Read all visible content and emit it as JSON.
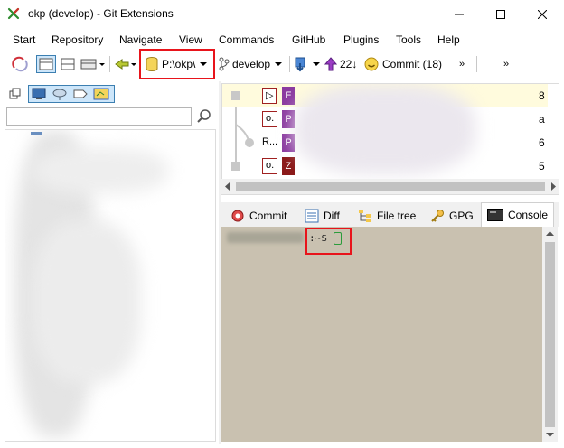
{
  "window": {
    "title": "okp (develop) - Git Extensions",
    "controls": [
      "minimize-icon",
      "maximize-icon",
      "close-icon"
    ]
  },
  "menu": {
    "items": [
      "Start",
      "Repository",
      "Navigate",
      "View",
      "Commands",
      "GitHub",
      "Plugins",
      "Tools",
      "Help"
    ]
  },
  "toolbar": {
    "repo_path": "P:\\okp\\",
    "branch": "develop",
    "ahead_count": "22↓",
    "commit_label": "Commit (18)",
    "overflow": "»"
  },
  "left_panel": {
    "search_placeholder": "",
    "icons": [
      "branches-icon",
      "remotes-icon",
      "tags-icon",
      "submodules-icon"
    ]
  },
  "revisions": {
    "rows": [
      {
        "ref": "▷",
        "avatar": "E",
        "avatar_color": "#8b3aa0",
        "right": "8",
        "selected": true
      },
      {
        "ref": "o.",
        "avatar": "P",
        "avatar_color": "#8b3aa0",
        "right": "a",
        "selected": false
      },
      {
        "ref": "R...",
        "avatar": "P",
        "avatar_color": "#8b3aa0",
        "right": "6",
        "selected": false
      },
      {
        "ref": "o.",
        "avatar": "Z",
        "avatar_color": "#8b1a1a",
        "right": "5",
        "selected": false
      }
    ]
  },
  "tabs": {
    "items": [
      {
        "label": "Commit",
        "icon": "commit-icon"
      },
      {
        "label": "Diff",
        "icon": "diff-icon"
      },
      {
        "label": "File tree",
        "icon": "file-tree-icon"
      },
      {
        "label": "GPG",
        "icon": "key-icon"
      },
      {
        "label": "Console",
        "icon": "console-icon",
        "active": true
      }
    ]
  },
  "console": {
    "prompt": ":~$"
  },
  "colors": {
    "highlight": "#e8141b",
    "console_bg": "#c9c1b0"
  }
}
